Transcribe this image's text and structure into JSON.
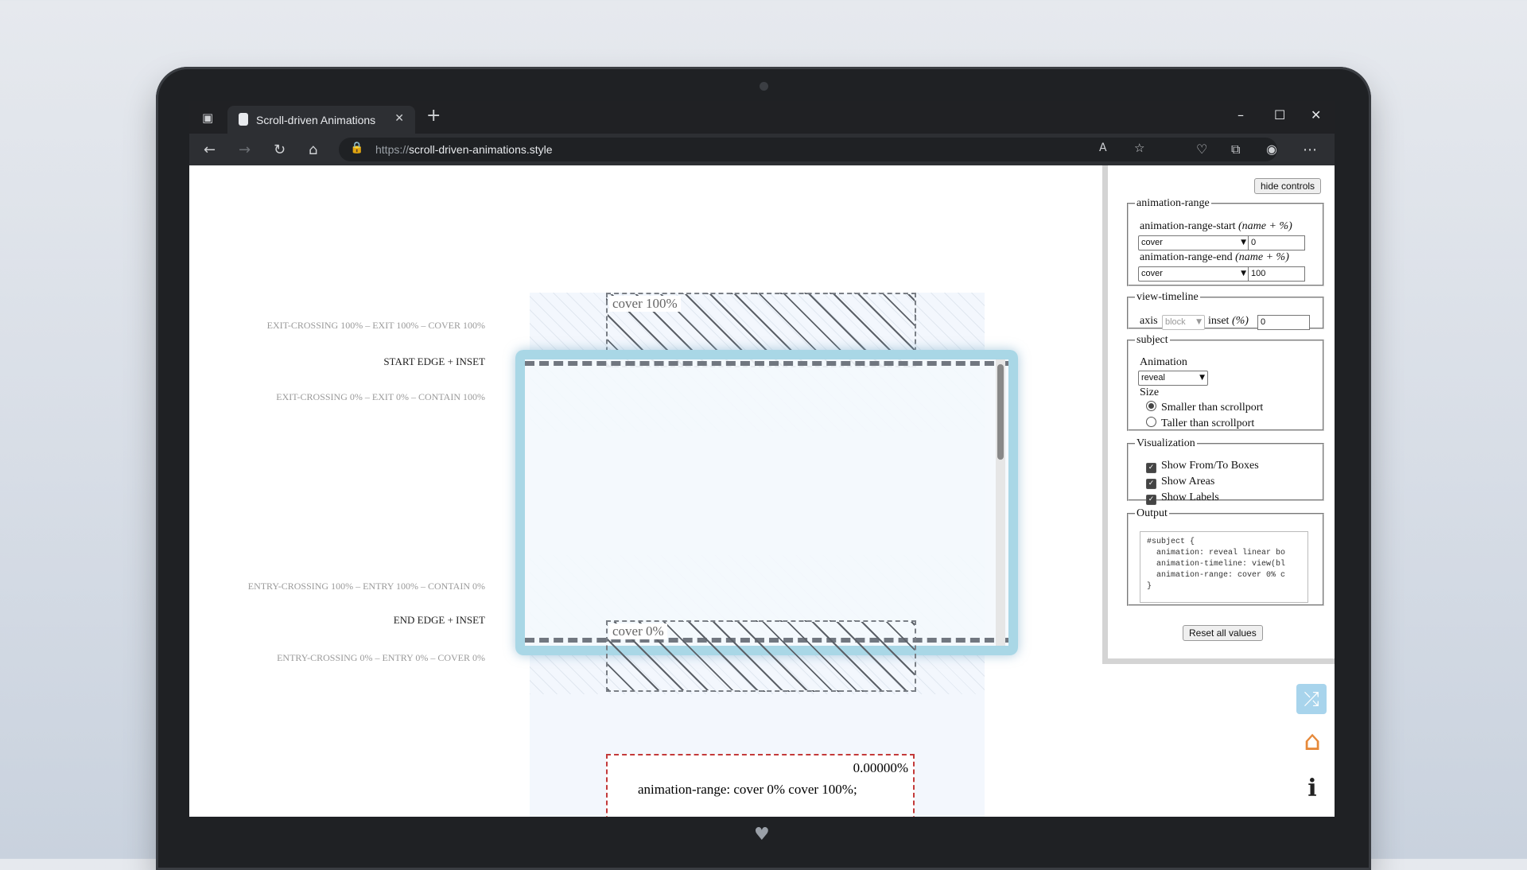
{
  "browser": {
    "tab_title": "Scroll-driven Animations",
    "url_protocol": "https://",
    "url_host": "scroll-driven-animations.style",
    "icons": [
      "tab-actions-icon",
      "close-icon",
      "new-tab-icon",
      "back-icon",
      "forward-icon",
      "refresh-icon",
      "home-icon",
      "lock-icon",
      "read-aloud-icon",
      "favorites-icon",
      "health-icon",
      "extensions-icon",
      "profile-icon",
      "more-icon",
      "minimize-icon",
      "maximize-icon",
      "window-close-icon"
    ]
  },
  "labels": {
    "exit_cross_100": "EXIT-CROSSING 100% – EXIT 100% – COVER 100%",
    "start_edge": "START EDGE + INSET",
    "exit_cross_0": "EXIT-CROSSING 0% – EXIT 0% – CONTAIN 100%",
    "entry_cross_100": "ENTRY-CROSSING 100% – ENTRY 100% – CONTAIN 0%",
    "end_edge": "END EDGE + INSET",
    "entry_cross_0": "ENTRY-CROSSING 0% – ENTRY 0% – COVER 0%"
  },
  "boxes": {
    "to_label": "cover 100%",
    "from_label": "cover 0%"
  },
  "result": {
    "progress": "0.00000%",
    "css": "animation-range: cover 0% cover 100%;"
  },
  "controls": {
    "hide_button": "hide controls",
    "range": {
      "legend": "animation-range",
      "start_label": "animation-range-start",
      "end_label": "animation-range-end",
      "hint": "(name + %)",
      "start_name": "cover",
      "start_value": "0",
      "end_name": "cover",
      "end_value": "100"
    },
    "timeline": {
      "legend": "view-timeline",
      "axis_label": "axis",
      "axis_value": "block",
      "inset_label": "inset",
      "inset_hint": "(%)",
      "inset_value": "0"
    },
    "subject": {
      "legend": "subject",
      "animation_label": "Animation",
      "animation_value": "reveal",
      "size_label": "Size",
      "size_opt1": "Smaller than scrollport",
      "size_opt2": "Taller than scrollport"
    },
    "viz": {
      "legend": "Visualization",
      "opt1": "Show From/To Boxes",
      "opt2": "Show Areas",
      "opt3": "Show Labels"
    },
    "output": {
      "legend": "Output",
      "code": "#subject {\n  animation: reveal linear bo\n  animation-timeline: view(bl\n  animation-range: cover 0% c\n}"
    },
    "reset_button": "Reset all values"
  },
  "side_icons": [
    "shuffle-icon",
    "home-house-icon",
    "info-icon"
  ],
  "colors": {
    "scrollport_border": "#a9d7e6",
    "result_border": "#c33a3a",
    "shuffle_bg": "#a8d4ec"
  }
}
